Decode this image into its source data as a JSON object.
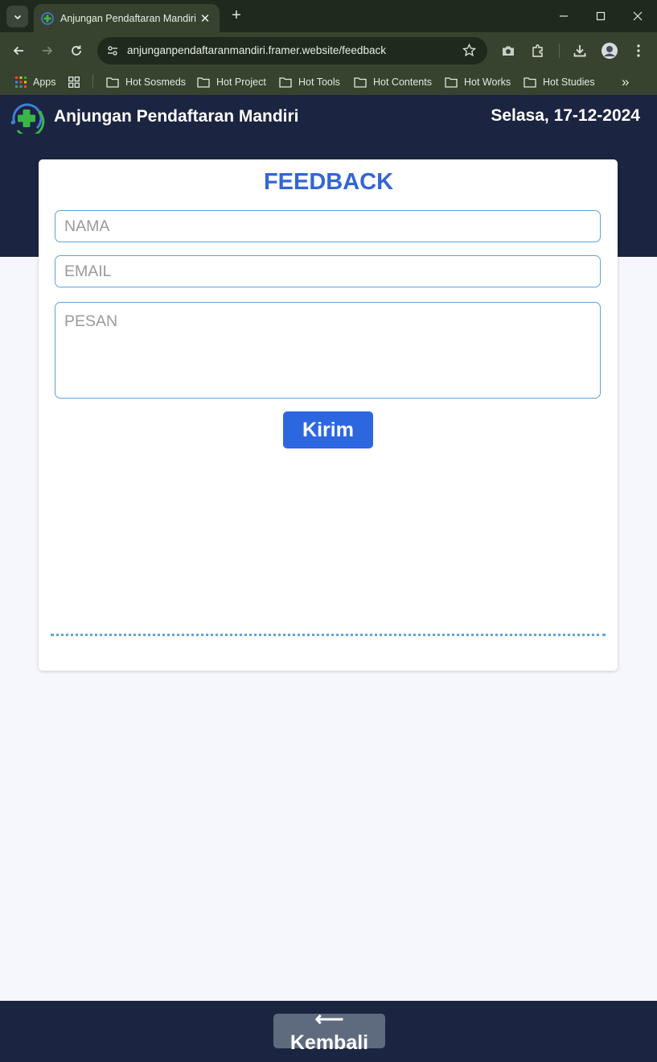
{
  "browser": {
    "tab_title": "Anjungan Pendaftaran Mandiri",
    "tab_close": "✕",
    "new_tab": "+",
    "url": "anjunganpendaftaranmandiri.framer.website/feedback",
    "bookmarks": [
      {
        "label": "Apps",
        "icon": "apps-grid-icon"
      },
      {
        "label": "Hot Sosmeds",
        "icon": "folder-icon"
      },
      {
        "label": "Hot Project",
        "icon": "folder-icon"
      },
      {
        "label": "Hot Tools",
        "icon": "folder-icon"
      },
      {
        "label": "Hot Contents",
        "icon": "folder-icon"
      },
      {
        "label": "Hot Works",
        "icon": "folder-icon"
      },
      {
        "label": "Hot Studies",
        "icon": "folder-icon"
      }
    ],
    "overflow": "»"
  },
  "header": {
    "title": "Anjungan Pendaftaran Mandiri",
    "date": "Selasa, 17-12-2024"
  },
  "form": {
    "title": "FEEDBACK",
    "name_placeholder": "NAMA",
    "email_placeholder": "EMAIL",
    "message_placeholder": "PESAN",
    "submit_label": "Kirim"
  },
  "footer": {
    "back_label": "⟵ Kembali"
  },
  "colors": {
    "header_bg": "#1b2440",
    "accent": "#3466d4",
    "button": "#2d67e0",
    "field_border": "#5fa4d8",
    "back_button": "#5e6b7e"
  }
}
